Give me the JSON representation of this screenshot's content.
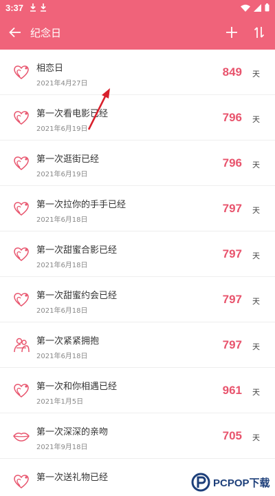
{
  "status": {
    "time": "3:37"
  },
  "appbar": {
    "title": "纪念日"
  },
  "colors": {
    "accent": "#f0637a",
    "count": "#e8546d",
    "icon": "#e8546d"
  },
  "items": [
    {
      "title": "相恋日",
      "date": "2021年4月27日",
      "count": "849",
      "unit": "天",
      "icon": "heart-ring-icon"
    },
    {
      "title": "第一次看电影已经",
      "date": "2021年6月19日",
      "count": "796",
      "unit": "天",
      "icon": "heart-ring-icon"
    },
    {
      "title": "第一次逛街已经",
      "date": "2021年6月19日",
      "count": "796",
      "unit": "天",
      "icon": "heart-ring-icon"
    },
    {
      "title": "第一次拉你的手手已经",
      "date": "2021年6月18日",
      "count": "797",
      "unit": "天",
      "icon": "heart-ring-icon"
    },
    {
      "title": "第一次甜蜜合影已经",
      "date": "2021年6月18日",
      "count": "797",
      "unit": "天",
      "icon": "heart-ring-icon"
    },
    {
      "title": "第一次甜蜜约会已经",
      "date": "2021年6月18日",
      "count": "797",
      "unit": "天",
      "icon": "heart-ring-icon"
    },
    {
      "title": "第一次紧紧拥抱",
      "date": "2021年6月18日",
      "count": "797",
      "unit": "天",
      "icon": "hug-icon"
    },
    {
      "title": "第一次和你相遇已经",
      "date": "2021年1月5日",
      "count": "961",
      "unit": "天",
      "icon": "heart-ring-icon"
    },
    {
      "title": "第一次深深的亲吻",
      "date": "2021年9月18日",
      "count": "705",
      "unit": "天",
      "icon": "lips-icon"
    },
    {
      "title": "第一次送礼物已经",
      "date": "",
      "count": "",
      "unit": "",
      "icon": "heart-ring-icon"
    }
  ],
  "watermark": {
    "text": "PCPOP下载"
  }
}
